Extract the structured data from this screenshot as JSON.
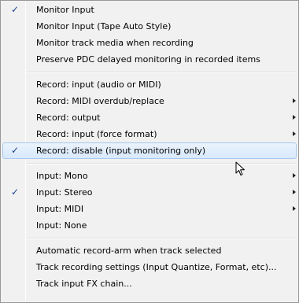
{
  "menu": {
    "groups": [
      [
        {
          "label": "Monitor Input",
          "checked": true,
          "submenu": false
        },
        {
          "label": "Monitor Input (Tape Auto Style)",
          "checked": false,
          "submenu": false
        },
        {
          "label": "Monitor track media when recording",
          "checked": false,
          "submenu": false
        },
        {
          "label": "Preserve PDC delayed monitoring in recorded items",
          "checked": false,
          "submenu": false
        }
      ],
      [
        {
          "label": "Record: input (audio or MIDI)",
          "checked": false,
          "submenu": false
        },
        {
          "label": "Record: MIDI overdub/replace",
          "checked": false,
          "submenu": true
        },
        {
          "label": "Record: output",
          "checked": false,
          "submenu": true
        },
        {
          "label": "Record: input (force format)",
          "checked": false,
          "submenu": true
        },
        {
          "label": "Record: disable (input monitoring only)",
          "checked": true,
          "submenu": false,
          "hover": true
        }
      ],
      [
        {
          "label": "Input: Mono",
          "checked": false,
          "submenu": true
        },
        {
          "label": "Input: Stereo",
          "checked": true,
          "submenu": true
        },
        {
          "label": "Input: MIDI",
          "checked": false,
          "submenu": true
        },
        {
          "label": "Input: None",
          "checked": false,
          "submenu": false
        }
      ],
      [
        {
          "label": "Automatic record-arm when track selected",
          "checked": false,
          "submenu": false
        },
        {
          "label": "Track recording settings (Input Quantize, Format, etc)...",
          "checked": false,
          "submenu": false
        },
        {
          "label": "Track input FX chain...",
          "checked": false,
          "submenu": false
        }
      ]
    ],
    "check_glyph": "✓",
    "icons": {
      "check": "checkmark-icon",
      "submenu": "submenu-arrow-icon",
      "cursor": "mouse-pointer-icon"
    }
  }
}
